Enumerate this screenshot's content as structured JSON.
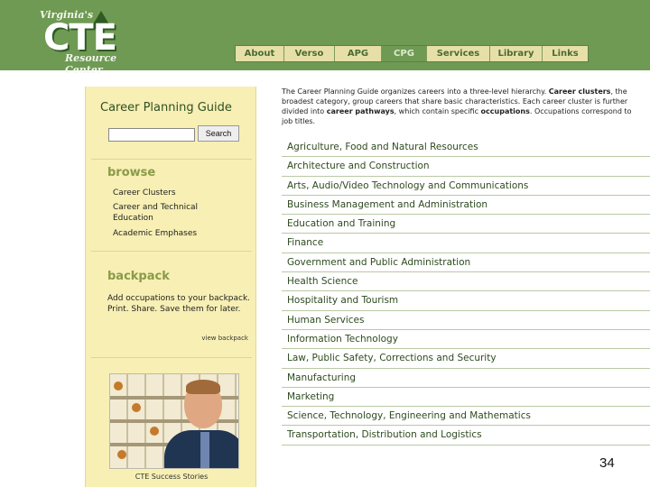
{
  "header": {
    "logo_top": "Virginia's",
    "logo_main": "CTE",
    "logo_bottom": "Resource Center",
    "nav": [
      {
        "label": "About",
        "active": false
      },
      {
        "label": "Verso",
        "active": false
      },
      {
        "label": "APG",
        "active": false
      },
      {
        "label": "CPG",
        "active": true
      },
      {
        "label": "Services",
        "active": false
      },
      {
        "label": "Library",
        "active": false
      },
      {
        "label": "Links",
        "active": false
      }
    ]
  },
  "sidebar": {
    "title": "Career Planning Guide",
    "search": {
      "placeholder": "",
      "button_label": "Search"
    },
    "browse": {
      "heading": "browse",
      "links": [
        "Career Clusters",
        "Career and Technical Education",
        "Academic Emphases"
      ]
    },
    "backpack": {
      "heading": "backpack",
      "text": "Add occupations to your backpack. Print. Share. Save them for later.",
      "link": "view backpack"
    },
    "photo_caption": "CTE Success Stories"
  },
  "main": {
    "intro_parts": [
      "The Career Planning Guide organizes careers into a three-level hierarchy. ",
      "Career clusters",
      ", the broadest category, group careers that share basic characteristics. Each career cluster is further divided into ",
      "career pathways",
      ", which contain specific ",
      "occupations",
      ". Occupations correspond to job titles."
    ],
    "clusters": [
      "Agriculture, Food and Natural Resources",
      "Architecture and Construction",
      "Arts, Audio/Video Technology and Communications",
      "Business Management and Administration",
      "Education and Training",
      "Finance",
      "Government and Public Administration",
      "Health Science",
      "Hospitality and Tourism",
      "Human Services",
      "Information Technology",
      "Law, Public Safety, Corrections and Security",
      "Manufacturing",
      "Marketing",
      "Science, Technology, Engineering and Mathematics",
      "Transportation, Distribution and Logistics"
    ]
  },
  "page_number": "34",
  "colors": {
    "header": "#6e9a53",
    "sidebar": "#f7efb4",
    "link": "#2d4a1e"
  }
}
